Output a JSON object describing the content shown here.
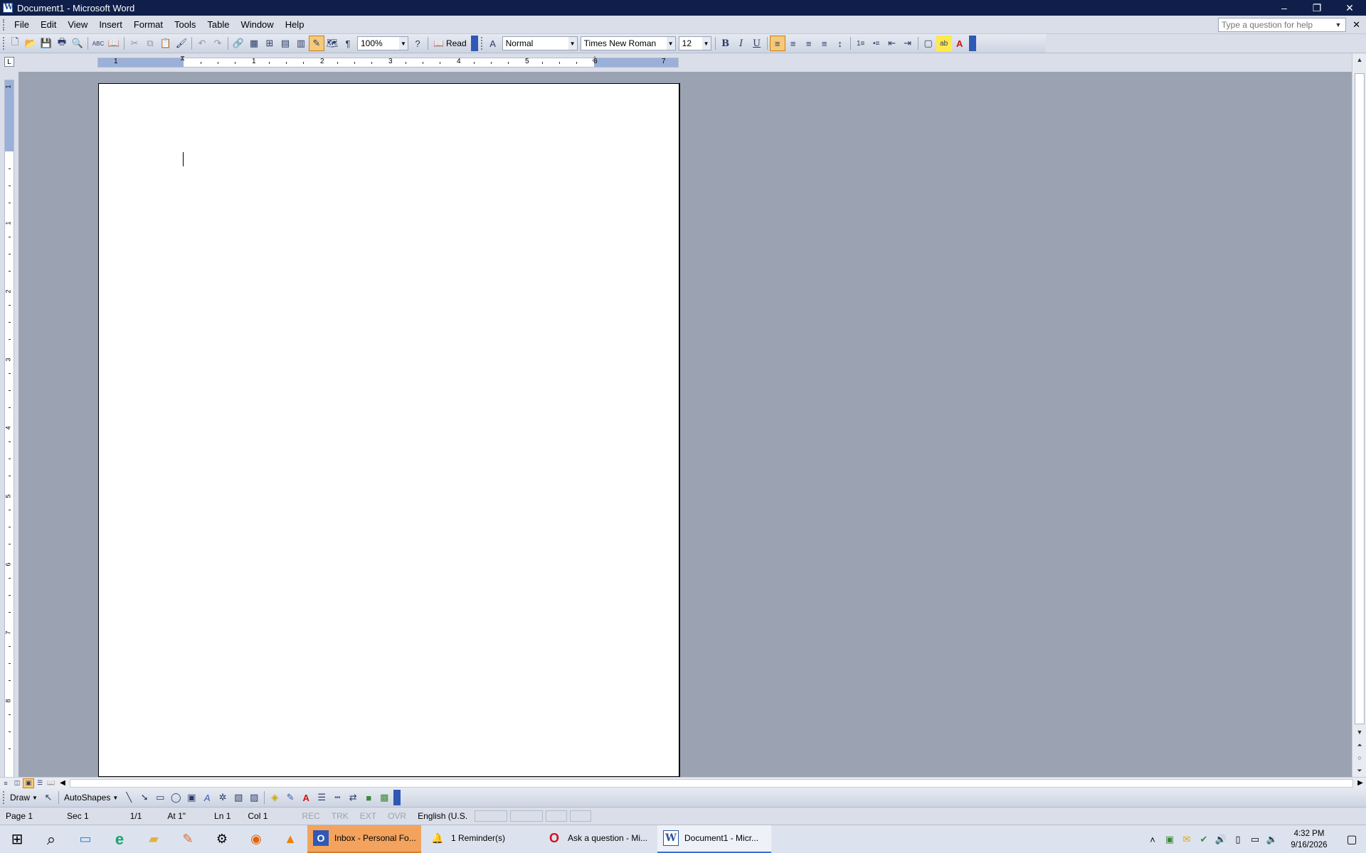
{
  "window": {
    "title": "Document1 - Microsoft Word",
    "minimize_glyph": "–",
    "restore_glyph": "❐",
    "close_glyph": "✕"
  },
  "menubar": {
    "items": [
      "File",
      "Edit",
      "View",
      "Insert",
      "Format",
      "Tools",
      "Table",
      "Window",
      "Help"
    ],
    "help_placeholder": "Type a question for help",
    "doc_close_glyph": "✕"
  },
  "toolbar": {
    "zoom": "100%",
    "read_label": "Read",
    "style": "Normal",
    "font": "Times New Roman",
    "size": "12",
    "bold": "B",
    "italic": "I",
    "underline": "U",
    "icons": {
      "new": "🗋",
      "open": "📂",
      "save": "💾",
      "print": "🖶",
      "preview": "🔍",
      "spelling": "ABC",
      "research": "📖",
      "cut": "✂",
      "copy": "⧉",
      "paste": "📋",
      "format_painter": "🖌",
      "undo": "↶",
      "redo": "↷",
      "hyperlink": "🔗",
      "tables_borders": "▦",
      "insert_table": "⊞",
      "insert_excel": "▤",
      "columns": "▥",
      "drawing": "✎",
      "document_map": "🗺",
      "show_hide": "¶",
      "help": "?",
      "styles": "A",
      "align_left": "≡",
      "center": "≡",
      "align_right": "≡",
      "justify": "≡",
      "line_spacing": "↕",
      "numbering": "1≡",
      "bullets": "•≡",
      "decrease_indent": "⇤",
      "increase_indent": "⇥",
      "border": "▢",
      "highlight": "ab",
      "font_color": "A"
    }
  },
  "ruler": {
    "horizontal_numbers": [
      "1",
      "1",
      "2",
      "3",
      "4",
      "5",
      "6",
      "7"
    ],
    "vertical_numbers": [
      "1",
      "1",
      "2",
      "3",
      "4",
      "5",
      "6",
      "7",
      "8"
    ],
    "corner_glyph": "L"
  },
  "drawbar": {
    "draw_label": "Draw",
    "autoshapes_label": "AutoShapes",
    "icons": {
      "select": "↖",
      "line": "╲",
      "arrow": "➘",
      "rectangle": "▭",
      "oval": "◯",
      "textbox": "▣",
      "wordart": "A",
      "diagram": "✲",
      "clipart": "▧",
      "picture": "▨",
      "fill": "◈",
      "line_color": "✎",
      "font_color": "A",
      "line_style": "☰",
      "dash_style": "┅",
      "arrow_style": "⇄",
      "shadow": "■",
      "3d": "▩"
    }
  },
  "statusbar": {
    "page": "Page 1",
    "sec": "Sec 1",
    "pages": "1/1",
    "at": "At 1\"",
    "ln": "Ln 1",
    "col": "Col 1",
    "rec": "REC",
    "trk": "TRK",
    "ext": "EXT",
    "ovr": "OVR",
    "language": "English (U.S."
  },
  "taskbar": {
    "tasks": [
      {
        "label": "Inbox - Personal Fo...",
        "icon": "O"
      },
      {
        "label": "1 Reminder(s)",
        "icon": "🔔"
      },
      {
        "label": "Ask a question - Mi...",
        "icon": "O"
      },
      {
        "label": "Document1 - Micr...",
        "icon": "W"
      }
    ],
    "time": "4:32 PM",
    "date": "9/16/2026",
    "icons": {
      "start": "⊞",
      "search": "⌕",
      "task_view": "▭",
      "edge": "e",
      "explorer": "▰",
      "paint": "✎",
      "settings": "⚙",
      "firefox": "◉",
      "vlc": "▲",
      "tray_up": "˄",
      "tray1": "▣",
      "tray2": "✉",
      "tray3": "✔",
      "volume": "🔊",
      "usb": "▯",
      "network": "▭",
      "speaker": "🔉",
      "notification": "▢"
    }
  }
}
